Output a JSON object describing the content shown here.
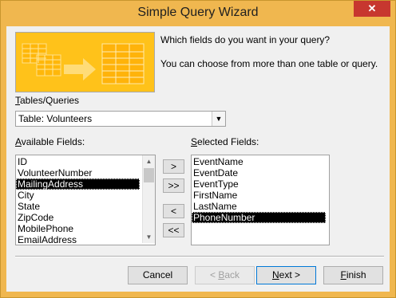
{
  "window": {
    "title": "Simple Query Wizard",
    "close_label": "✕",
    "frame_color": "#f0b74f",
    "close_color": "#c7372f"
  },
  "intro": {
    "question": "Which fields do you want in your query?",
    "hint": "You can choose from more than one table or query."
  },
  "tables": {
    "label_access_key": "T",
    "label_rest": "ables/Queries",
    "selected": "Table: Volunteers",
    "dropdown_icon": "chevron-down-icon"
  },
  "available": {
    "label_access_key": "A",
    "label_rest": "vailable Fields:",
    "items": [
      "ID",
      "VolunteerNumber",
      "MailingAddress",
      "City",
      "State",
      "ZipCode",
      "MobilePhone",
      "EmailAddress"
    ],
    "selected_item": "MailingAddress"
  },
  "selected_fields": {
    "label_access_key": "S",
    "label_rest": "elected Fields:",
    "items": [
      "EventName",
      "EventDate",
      "EventType",
      "FirstName",
      "LastName",
      "PhoneNumber"
    ],
    "selected_item": "PhoneNumber"
  },
  "move": {
    "add_one": ">",
    "add_all": ">>",
    "remove_one": "<",
    "remove_all": "<<"
  },
  "buttons": {
    "cancel": "Cancel",
    "back_key": "< ",
    "back_u": "B",
    "back_rest": "ack",
    "next_u": "N",
    "next_rest": "ext >",
    "finish_u": "F",
    "finish_rest": "inish"
  }
}
